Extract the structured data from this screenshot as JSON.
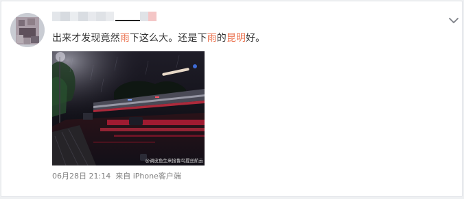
{
  "post": {
    "author_name": "",
    "text_segments": [
      {
        "text": "出来才发现竟然",
        "highlight": false
      },
      {
        "text": "雨",
        "highlight": true
      },
      {
        "text": "下这么大。还是下",
        "highlight": false
      },
      {
        "text": "雨",
        "highlight": true
      },
      {
        "text": "的",
        "highlight": false
      },
      {
        "text": "昆明",
        "highlight": true
      },
      {
        "text": "好。",
        "highlight": false
      }
    ],
    "image_watermark": "@调皮鱼生来接鲁鸟提丝航云",
    "timestamp": "06月28日 21:14",
    "source": "来自 iPhone客户端"
  },
  "icons": {
    "menu": "chevron-down-icon"
  },
  "colors": {
    "highlight": "#eb7350",
    "text": "#333333",
    "meta": "#808080"
  }
}
